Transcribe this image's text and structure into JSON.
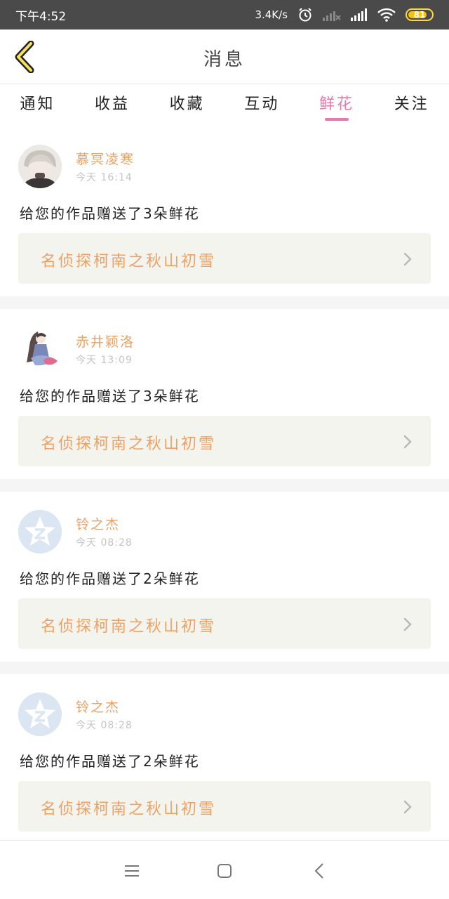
{
  "status_bar": {
    "time": "下午4:52",
    "network_speed": "3.4K/s",
    "battery": "81",
    "battery_level": 0.81
  },
  "header": {
    "title": "消息",
    "back_icon": "chevron-left-icon"
  },
  "tabs": [
    {
      "label": "通知",
      "active": false
    },
    {
      "label": "收益",
      "active": false
    },
    {
      "label": "收藏",
      "active": false
    },
    {
      "label": "互动",
      "active": false
    },
    {
      "label": "鲜花",
      "active": true
    },
    {
      "label": "关注",
      "active": false
    }
  ],
  "colors": {
    "accent": "#e879a9",
    "name": "#f0a060",
    "card_bg": "#f4f4ef"
  },
  "notifications": [
    {
      "username": "慕冥凌寒",
      "time": "今天 16:14",
      "message": "给您的作品赠送了3朵鲜花",
      "work_title": "名侦探柯南之秋山初雪",
      "avatar": "anime-avatar"
    },
    {
      "username": "赤井颖洛",
      "time": "今天 13:09",
      "message": "给您的作品赠送了3朵鲜花",
      "work_title": "名侦探柯南之秋山初雪",
      "avatar": "anime-girl-avatar"
    },
    {
      "username": "铃之杰",
      "time": "今天 08:28",
      "message": "给您的作品赠送了2朵鲜花",
      "work_title": "名侦探柯南之秋山初雪",
      "avatar": "default-qq-avatar"
    },
    {
      "username": "铃之杰",
      "time": "今天 08:28",
      "message": "给您的作品赠送了2朵鲜花",
      "work_title": "名侦探柯南之秋山初雪",
      "avatar": "default-qq-avatar"
    }
  ],
  "navbar": {
    "icons": [
      "menu-icon",
      "home-icon",
      "back-icon"
    ]
  }
}
